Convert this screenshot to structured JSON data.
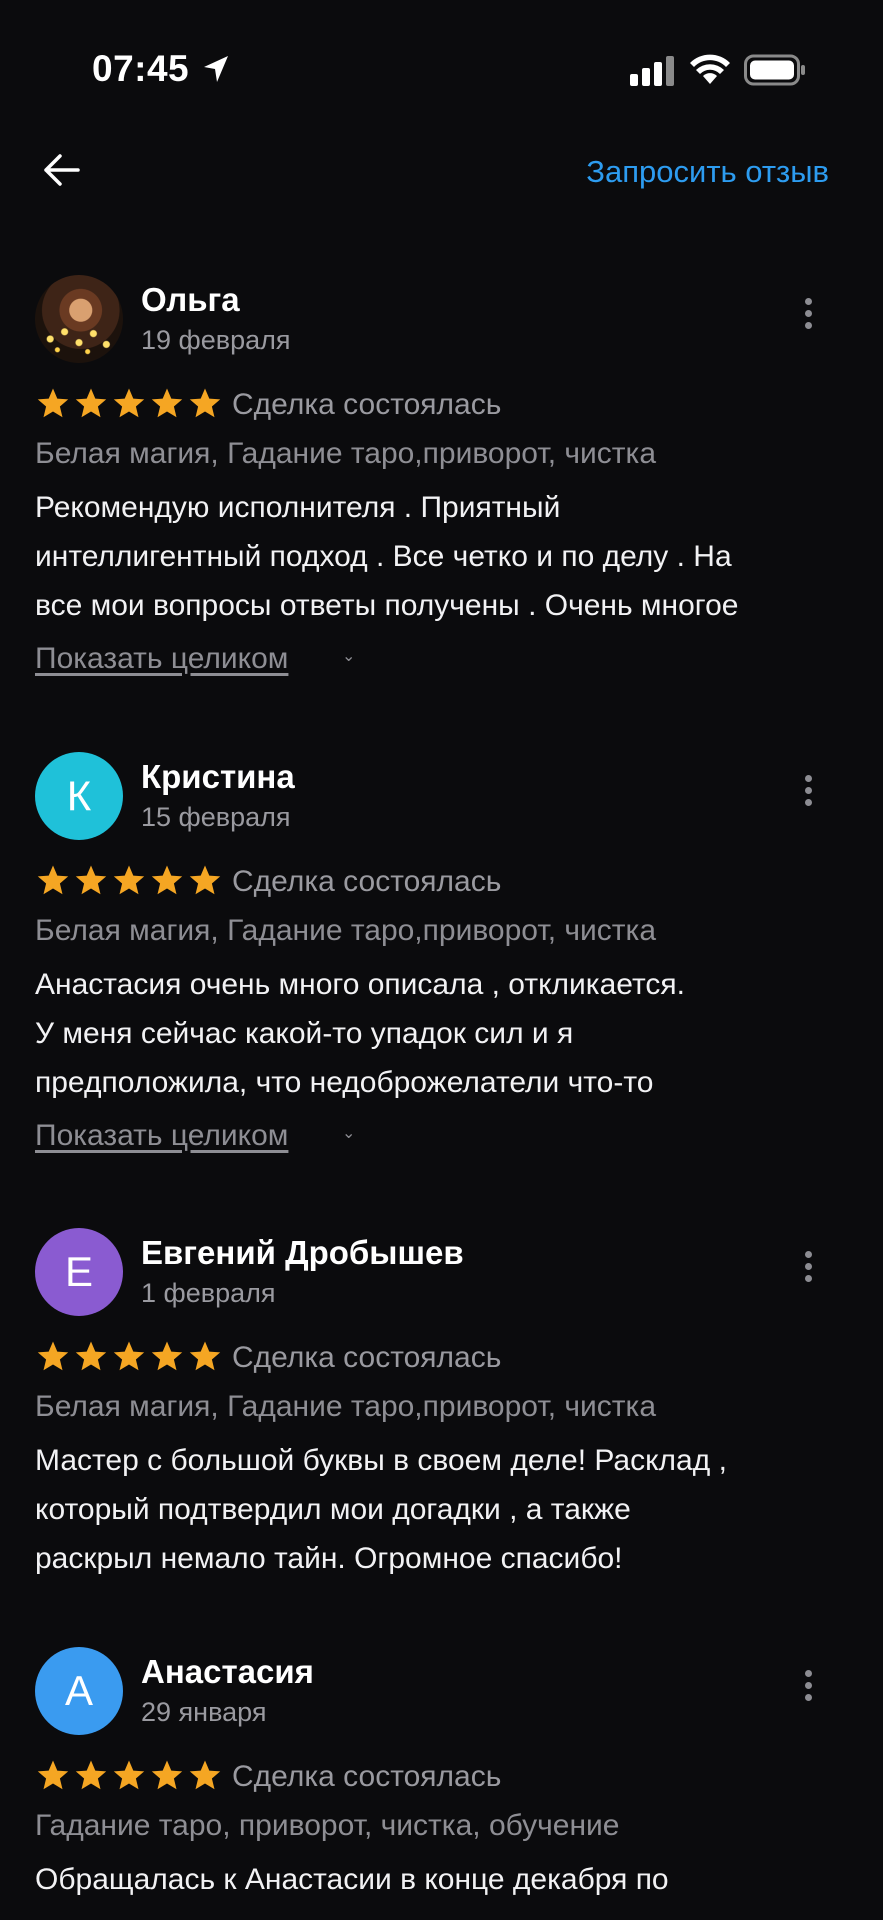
{
  "status_bar": {
    "time": "07:45"
  },
  "header": {
    "request_review_label": "Запросить отзыв"
  },
  "colors": {
    "accent": "#2d9cf0",
    "star": "#f5a623",
    "background": "#0b0b0d"
  },
  "reviews": [
    {
      "name": "Ольга",
      "date": "19 февраля",
      "avatar_type": "photo",
      "avatar_letter": "",
      "rating": 5,
      "status": "Сделка состоялась",
      "tags": "Белая магия, Гадание таро,приворот, чистка",
      "text_lines": [
        "Рекомендую исполнителя . Приятный",
        "интеллигентный подход . Все четко и по делу . На",
        "все мои вопросы ответы получены . Очень многое"
      ],
      "show_more": "Показать целиком"
    },
    {
      "name": "Кристина",
      "date": "15 февраля",
      "avatar_type": "letter",
      "avatar_letter": "К",
      "avatar_color": "#1fc1d9",
      "rating": 5,
      "status": "Сделка состоялась",
      "tags": "Белая магия, Гадание таро,приворот, чистка",
      "text_lines": [
        "Анастасия очень много описала , откликается.",
        "У меня сейчас какой-то упадок сил и я",
        "предположила, что недоброжелатели что-то"
      ],
      "show_more": "Показать целиком"
    },
    {
      "name": "Евгений Дробышев",
      "date": "1 февраля",
      "avatar_type": "letter",
      "avatar_letter": "Е",
      "avatar_color": "#8a5bd1",
      "rating": 5,
      "status": "Сделка состоялась",
      "tags": "Белая магия, Гадание таро,приворот, чистка",
      "text_lines": [
        "Мастер с большой буквы в своем деле! Расклад ,",
        "который подтвердил мои догадки , а также",
        "раскрыл немало тайн. Огромное спасибо!"
      ],
      "show_more": ""
    },
    {
      "name": "Анастасия",
      "date": "29 января",
      "avatar_type": "letter",
      "avatar_letter": "А",
      "avatar_color": "#3a9bf0",
      "rating": 5,
      "status": "Сделка состоялась",
      "tags": "Гадание таро, приворот, чистка, обучение",
      "text_lines": [
        "Обращалась к Анастасии в конце декабря по"
      ],
      "show_more": ""
    }
  ]
}
